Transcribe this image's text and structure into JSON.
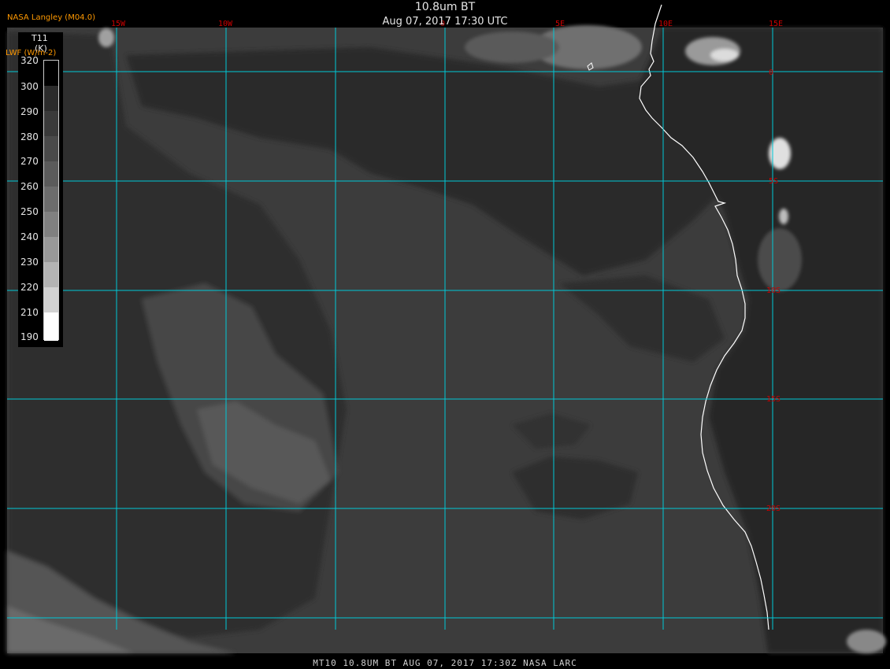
{
  "header": {
    "title": "10.8um BT",
    "subtitle": "Aug 07, 2017 17:30 UTC",
    "credit": "NASA Langley (M04.0)",
    "footer": "MT10  10.8UM BT   AUG 07, 2017 17:30Z   NASA LARC"
  },
  "legend": {
    "variable": "T11",
    "unit": "(K)",
    "overlay": "LWF (W/m-2)",
    "labels": [
      "320",
      "300",
      "290",
      "280",
      "270",
      "260",
      "250",
      "240",
      "230",
      "220",
      "210",
      "190"
    ]
  },
  "grid": {
    "longitude_labels": [
      "15W",
      "10W",
      "0",
      "5E",
      "10E",
      "15E"
    ],
    "latitude_labels": [
      "0",
      "5S",
      "10S",
      "15S",
      "20S"
    ],
    "line_color": "#00c8d6",
    "label_color": "#cc0000"
  },
  "colors": {
    "background": "#000000",
    "ocean": "#3c3c3c",
    "land": "#282828",
    "coastline": "#ffffff"
  }
}
